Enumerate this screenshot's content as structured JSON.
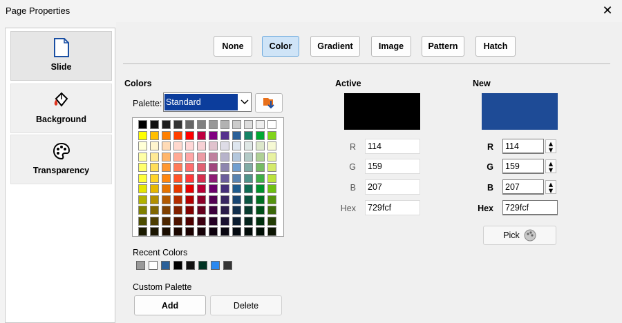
{
  "dialog": {
    "title": "Page Properties",
    "close_glyph": "✕"
  },
  "sidebar": {
    "items": [
      {
        "label": "Slide",
        "icon": "page-icon"
      },
      {
        "label": "Background",
        "icon": "paint-bucket-icon"
      },
      {
        "label": "Transparency",
        "icon": "palette-icon"
      }
    ]
  },
  "tabs": [
    "None",
    "Color",
    "Gradient",
    "Image",
    "Pattern",
    "Hatch"
  ],
  "active_tab": "Color",
  "colors": {
    "heading": "Colors",
    "palette_label": "Palette:",
    "palette_value": "Standard",
    "grid": [
      [
        "#000000",
        "#111111",
        "#1c1c1c",
        "#333333",
        "#666666",
        "#808080",
        "#999999",
        "#b2b2b2",
        "#cccccc",
        "#dddddd",
        "#eeeeee",
        "#ffffff"
      ],
      [
        "#ffff00",
        "#ffbf00",
        "#ff8000",
        "#ff4000",
        "#ff0000",
        "#bf0041",
        "#800080",
        "#55308d",
        "#2a6099",
        "#158466",
        "#00a933",
        "#81d41a"
      ],
      [
        "#ffffd7",
        "#fff5ce",
        "#ffdbb6",
        "#ffd8ce",
        "#ffd7d7",
        "#f7d1d5",
        "#e0c2cd",
        "#dedce6",
        "#dee6ef",
        "#dee7e5",
        "#dde8cb",
        "#f6f9d4"
      ],
      [
        "#ffffa6",
        "#ffe994",
        "#ffb66c",
        "#ffaa95",
        "#ffa6a6",
        "#ec9ba4",
        "#bf819e",
        "#b7b3ca",
        "#b4c7dc",
        "#b3cac7",
        "#afd095",
        "#e8f2a1"
      ],
      [
        "#ffff6d",
        "#ffde59",
        "#ff972f",
        "#ff7b59",
        "#ff6d6d",
        "#e16173",
        "#a1467e",
        "#8e86ae",
        "#729fcf",
        "#81aca6",
        "#77bc65",
        "#d4ea6b"
      ],
      [
        "#ffff38",
        "#ffd428",
        "#ff860d",
        "#ff5429",
        "#ff3838",
        "#d62e4e",
        "#8d1d75",
        "#6b5e9b",
        "#5983b0",
        "#50938a",
        "#3faf46",
        "#bbe33d"
      ],
      [
        "#e6e600",
        "#e6b700",
        "#e67300",
        "#e63900",
        "#e60000",
        "#b80035",
        "#6b006b",
        "#452f79",
        "#1e5a8c",
        "#0f6b52",
        "#00902b",
        "#6ebf13"
      ],
      [
        "#b2b200",
        "#b28f00",
        "#b25900",
        "#b22d00",
        "#b20000",
        "#8c0028",
        "#520052",
        "#382661",
        "#174471",
        "#0a5340",
        "#006e21",
        "#55930f"
      ],
      [
        "#808000",
        "#806600",
        "#804000",
        "#802000",
        "#800000",
        "#64001d",
        "#3c003c",
        "#2a1c49",
        "#112e4c",
        "#073a2e",
        "#004e18",
        "#3c680a"
      ],
      [
        "#4d4d00",
        "#4d3d00",
        "#4d2600",
        "#4d1300",
        "#4d0000",
        "#3c0011",
        "#240024",
        "#191130",
        "#0a1c30",
        "#04231c",
        "#002f0e",
        "#243d06"
      ],
      [
        "#1a1a00",
        "#1a1400",
        "#1a0d00",
        "#1a0600",
        "#1a0000",
        "#140006",
        "#0c000c",
        "#080610",
        "#030910",
        "#010b09",
        "#000f05",
        "#0c1402"
      ]
    ],
    "recent_label": "Recent Colors",
    "recent": [
      "#999999",
      "#ffffff",
      "#2a6099",
      "#000000",
      "#111111",
      "#003322",
      "#2a89f0",
      "#333333"
    ],
    "custom_label": "Custom Palette",
    "add_label": "Add",
    "delete_label": "Delete"
  },
  "active": {
    "heading": "Active",
    "swatch": "#000000",
    "r_label": "R",
    "g_label": "G",
    "b_label": "B",
    "hex_label": "Hex",
    "r": "114",
    "g": "159",
    "b": "207",
    "hex": "729fcf"
  },
  "new": {
    "heading": "New",
    "swatch": "#1e4b96",
    "r_label": "R",
    "g_label": "G",
    "b_label": "B",
    "hex_label": "Hex",
    "r": "114",
    "g": "159",
    "b": "207",
    "hex": "729fcf",
    "pick_label": "Pick"
  }
}
